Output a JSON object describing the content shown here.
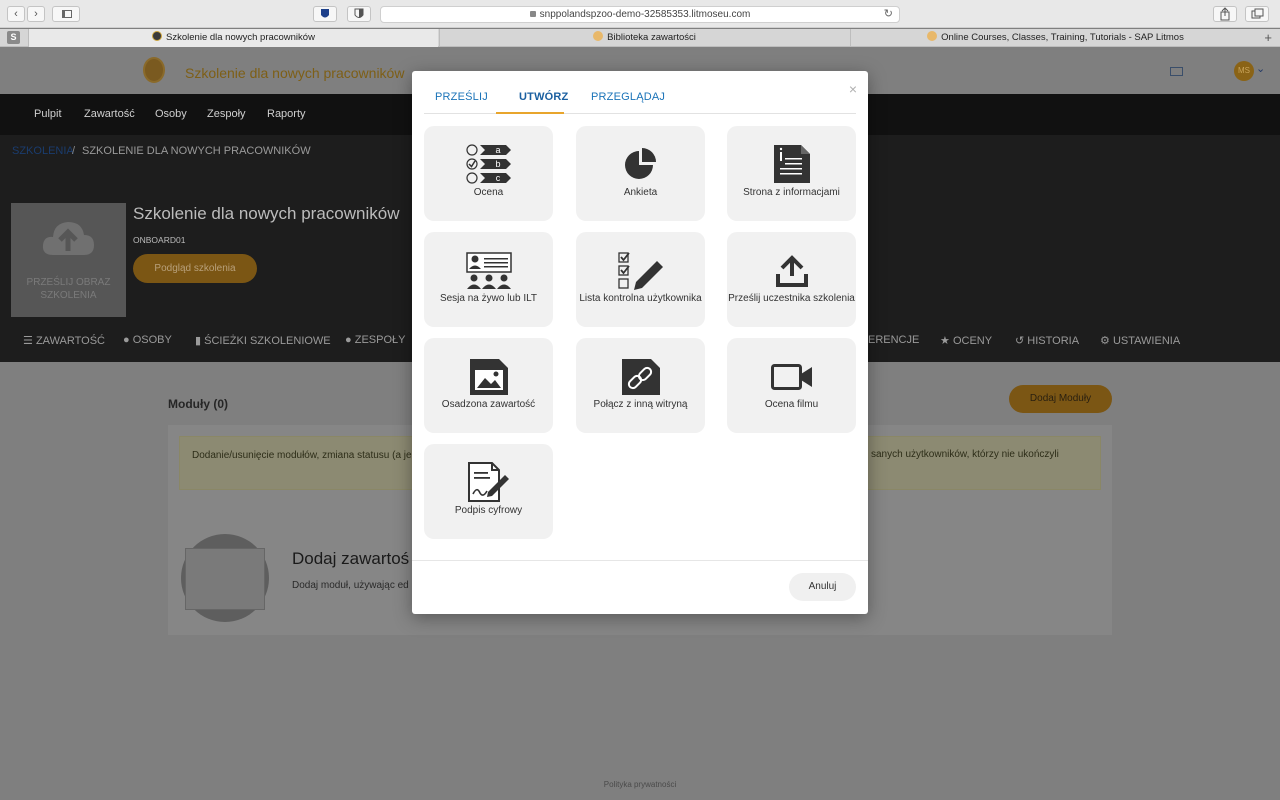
{
  "browser": {
    "url": "snppolandspzoo-demo-32585353.litmoseu.com",
    "tabs": [
      {
        "label": "Szkolenie dla nowych pracowników"
      },
      {
        "label": "Biblioteka zawartości"
      },
      {
        "label": "Online Courses, Classes, Training, Tutorials - SAP Litmos"
      }
    ],
    "new_tab": "+"
  },
  "app": {
    "title": "Szkolenie dla nowych pracowników",
    "avatar_initials": "MS"
  },
  "topnav": [
    "Pulpit",
    "Zawartość",
    "Osoby",
    "Zespoły",
    "Raporty"
  ],
  "breadcrumb": {
    "link": "SZKOLENIA",
    "separator": "/",
    "current": "SZKOLENIE DLA NOWYCH PRACOWNIKÓW"
  },
  "course": {
    "title": "Szkolenie dla nowych pracowników",
    "code": "ONBOARD01",
    "cover_label": "PRZEŚLIJ OBRAZ SZKOLENIA",
    "preview_button": "Podgląd szkolenia"
  },
  "subnav": [
    "ZAWARTOŚĆ",
    "OSOBY",
    "ŚCIEŻKI SZKOLENIOWE",
    "ZESPOŁY",
    "ERENCJE",
    "OCENY",
    "HISTORIA",
    "USTAWIENIA"
  ],
  "modules": {
    "title": "Moduły (0)",
    "add_button": "Dodaj Moduły",
    "alert_left": "Dodanie/usunięcie modułów, zmiana statusu (a jeszcze szkolenia.",
    "alert_right": "sanych użytkowników, którzy nie ukończyli",
    "empty_title": "Dodaj zawartoś",
    "empty_desc": "Dodaj moduł, używając ed"
  },
  "footer": {
    "privacy": "Polityka prywatności"
  },
  "modal": {
    "close": "×",
    "tabs": [
      "PRZEŚLIJ",
      "UTWÓRZ",
      "PRZEGLĄDAJ"
    ],
    "tiles": [
      {
        "label": "Ocena",
        "icon": "assessment-icon"
      },
      {
        "label": "Ankieta",
        "icon": "pie-chart-icon"
      },
      {
        "label": "Strona z informacjami",
        "icon": "document-icon"
      },
      {
        "label": "Sesja na żywo lub ILT",
        "icon": "live-session-icon"
      },
      {
        "label": "Lista kontrolna użytkownika",
        "icon": "checklist-icon"
      },
      {
        "label": "Prześlij uczestnika szkolenia",
        "icon": "upload-icon"
      },
      {
        "label": "Osadzona zawartość",
        "icon": "image-icon"
      },
      {
        "label": "Połącz z inną witryną",
        "icon": "link-icon"
      },
      {
        "label": "Ocena filmu",
        "icon": "video-icon"
      },
      {
        "label": "Podpis cyfrowy",
        "icon": "signature-icon"
      }
    ],
    "assessment_letters": [
      "a",
      "b",
      "c"
    ],
    "cancel": "Anuluj"
  }
}
